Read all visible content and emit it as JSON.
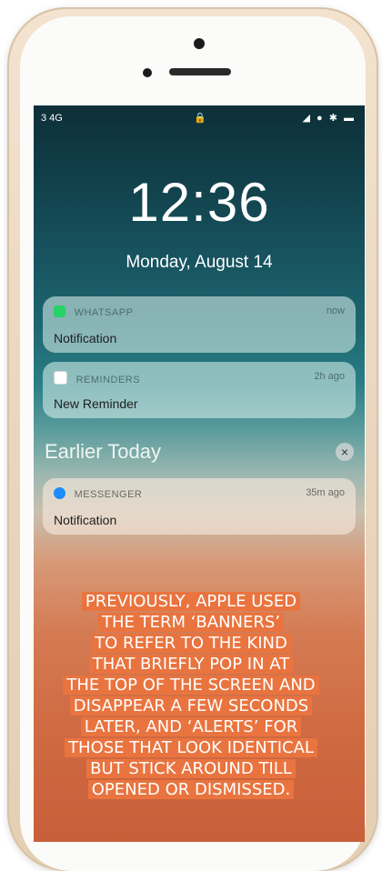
{
  "status_bar": {
    "signal": "3 4G",
    "right": "◢ ● ✱ ▬"
  },
  "lock_screen": {
    "time": "12:36",
    "date": "Monday, August 14"
  },
  "notifications": [
    {
      "app": "WHATSAPP",
      "time": "now",
      "text": "Notification",
      "color": "#25d366"
    },
    {
      "app": "REMINDERS",
      "time": "2h ago",
      "text": "New Reminder",
      "color": "#ffffff"
    }
  ],
  "earlier": {
    "title": "Earlier Today",
    "clear": "×"
  },
  "earlier_notifications": [
    {
      "app": "MESSENGER",
      "time": "35m ago",
      "text": "Notification",
      "color": "#1e8bff"
    }
  ],
  "caption_lines": [
    "PREVIOUSLY, APPLE USED",
    "THE TERM ‘BANNERS’",
    "TO REFER TO THE KIND",
    "THAT BRIEFLY POP IN AT",
    "THE TOP OF THE SCREEN AND",
    "DISAPPEAR A FEW SECONDS",
    "LATER, AND ‘ALERTS’ FOR",
    "THOSE THAT LOOK IDENTICAL",
    "BUT STICK AROUND TILL",
    "OPENED OR DISMISSED."
  ]
}
